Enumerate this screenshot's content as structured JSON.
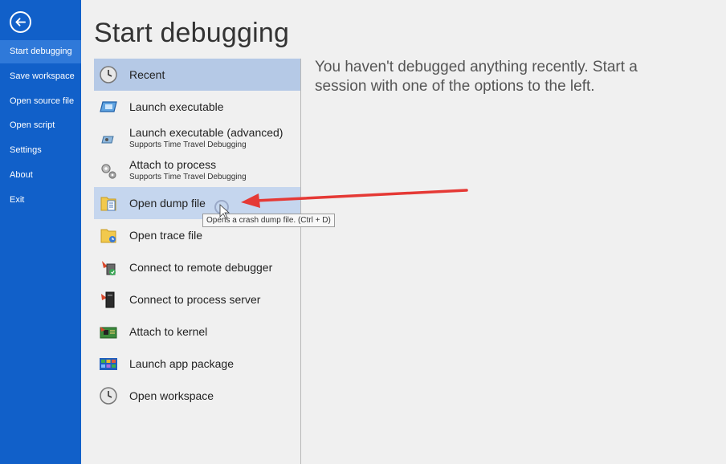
{
  "sidebar": {
    "items": [
      {
        "label": "Start debugging",
        "active": true
      },
      {
        "label": "Save workspace"
      },
      {
        "label": "Open source file"
      },
      {
        "label": "Open script"
      },
      {
        "label": "Settings"
      },
      {
        "label": "About"
      },
      {
        "label": "Exit"
      }
    ]
  },
  "main": {
    "title": "Start debugging",
    "message": "You haven't debugged anything recently. Start a session with one of the options to the left.",
    "options": [
      {
        "label": "Recent",
        "icon": "clock-icon",
        "state": "selected"
      },
      {
        "label": "Launch executable",
        "icon": "executable-icon"
      },
      {
        "label": "Launch executable (advanced)",
        "sub": "Supports Time Travel Debugging",
        "icon": "advanced-executable-icon"
      },
      {
        "label": "Attach to process",
        "sub": "Supports Time Travel Debugging",
        "icon": "gears-icon"
      },
      {
        "label": "Open dump file",
        "icon": "dump-file-icon",
        "state": "hover"
      },
      {
        "label": "Open trace file",
        "icon": "trace-file-icon"
      },
      {
        "label": "Connect to remote debugger",
        "icon": "remote-debugger-icon"
      },
      {
        "label": "Connect to process server",
        "icon": "process-server-icon"
      },
      {
        "label": "Attach to kernel",
        "icon": "kernel-icon"
      },
      {
        "label": "Launch app package",
        "icon": "app-package-icon"
      },
      {
        "label": "Open workspace",
        "icon": "workspace-clock-icon"
      }
    ],
    "tooltip": "Opens a crash dump file. (Ctrl + D)"
  },
  "colors": {
    "sidebar_bg": "#1160c9",
    "selected_bg": "#b5c9e6",
    "annotation_arrow": "#e53935"
  }
}
